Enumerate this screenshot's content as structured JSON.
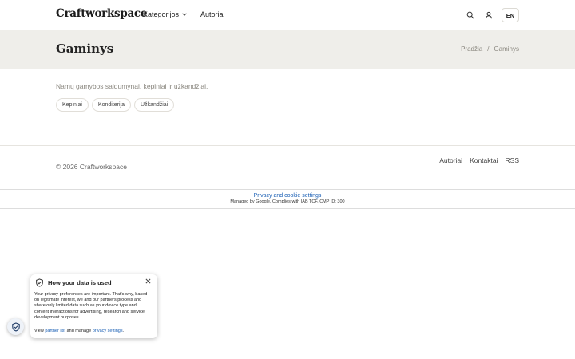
{
  "header": {
    "logo": "Craftworkspace",
    "nav": [
      {
        "label": "Kategorijos"
      },
      {
        "label": "Autoriai"
      }
    ],
    "icons": [
      "search-icon",
      "user-icon"
    ],
    "language": "EN"
  },
  "page": {
    "title": "Gaminys",
    "breadcrumb": {
      "home": "Pradžia",
      "separator": "/",
      "current": "Gaminys"
    }
  },
  "main": {
    "description": "Namų gamybos saldumynai, kepiniai ir užkandžiai.",
    "tags": [
      {
        "label": "Kepiniai"
      },
      {
        "label": "Konditerija"
      },
      {
        "label": "Užkandžiai"
      }
    ]
  },
  "footer": {
    "copyright": "© 2026 Craftworkspace",
    "links": [
      {
        "label": "Autoriai"
      },
      {
        "label": "Kontaktai"
      },
      {
        "label": "RSS"
      }
    ]
  },
  "privacy_bar": {
    "link": "Privacy and cookie settings",
    "note": "Managed by Google. Complies with IAB TCF. CMP ID: 300"
  },
  "consent": {
    "title": "How your data is used",
    "body": "Your privacy preferences are important. That's why, based on legitimate interest, we and our partners process and share only limited data such as your device type and content interactions for advertising, research and service development purposes.",
    "footer_prefix": "View",
    "partner_link": "partner list",
    "footer_middle": "and manage",
    "settings_link": "privacy settings",
    "footer_suffix": "."
  },
  "colors": {
    "band": "#efeeea",
    "link_blue": "#1a5fb4",
    "muted": "#8a877f"
  }
}
